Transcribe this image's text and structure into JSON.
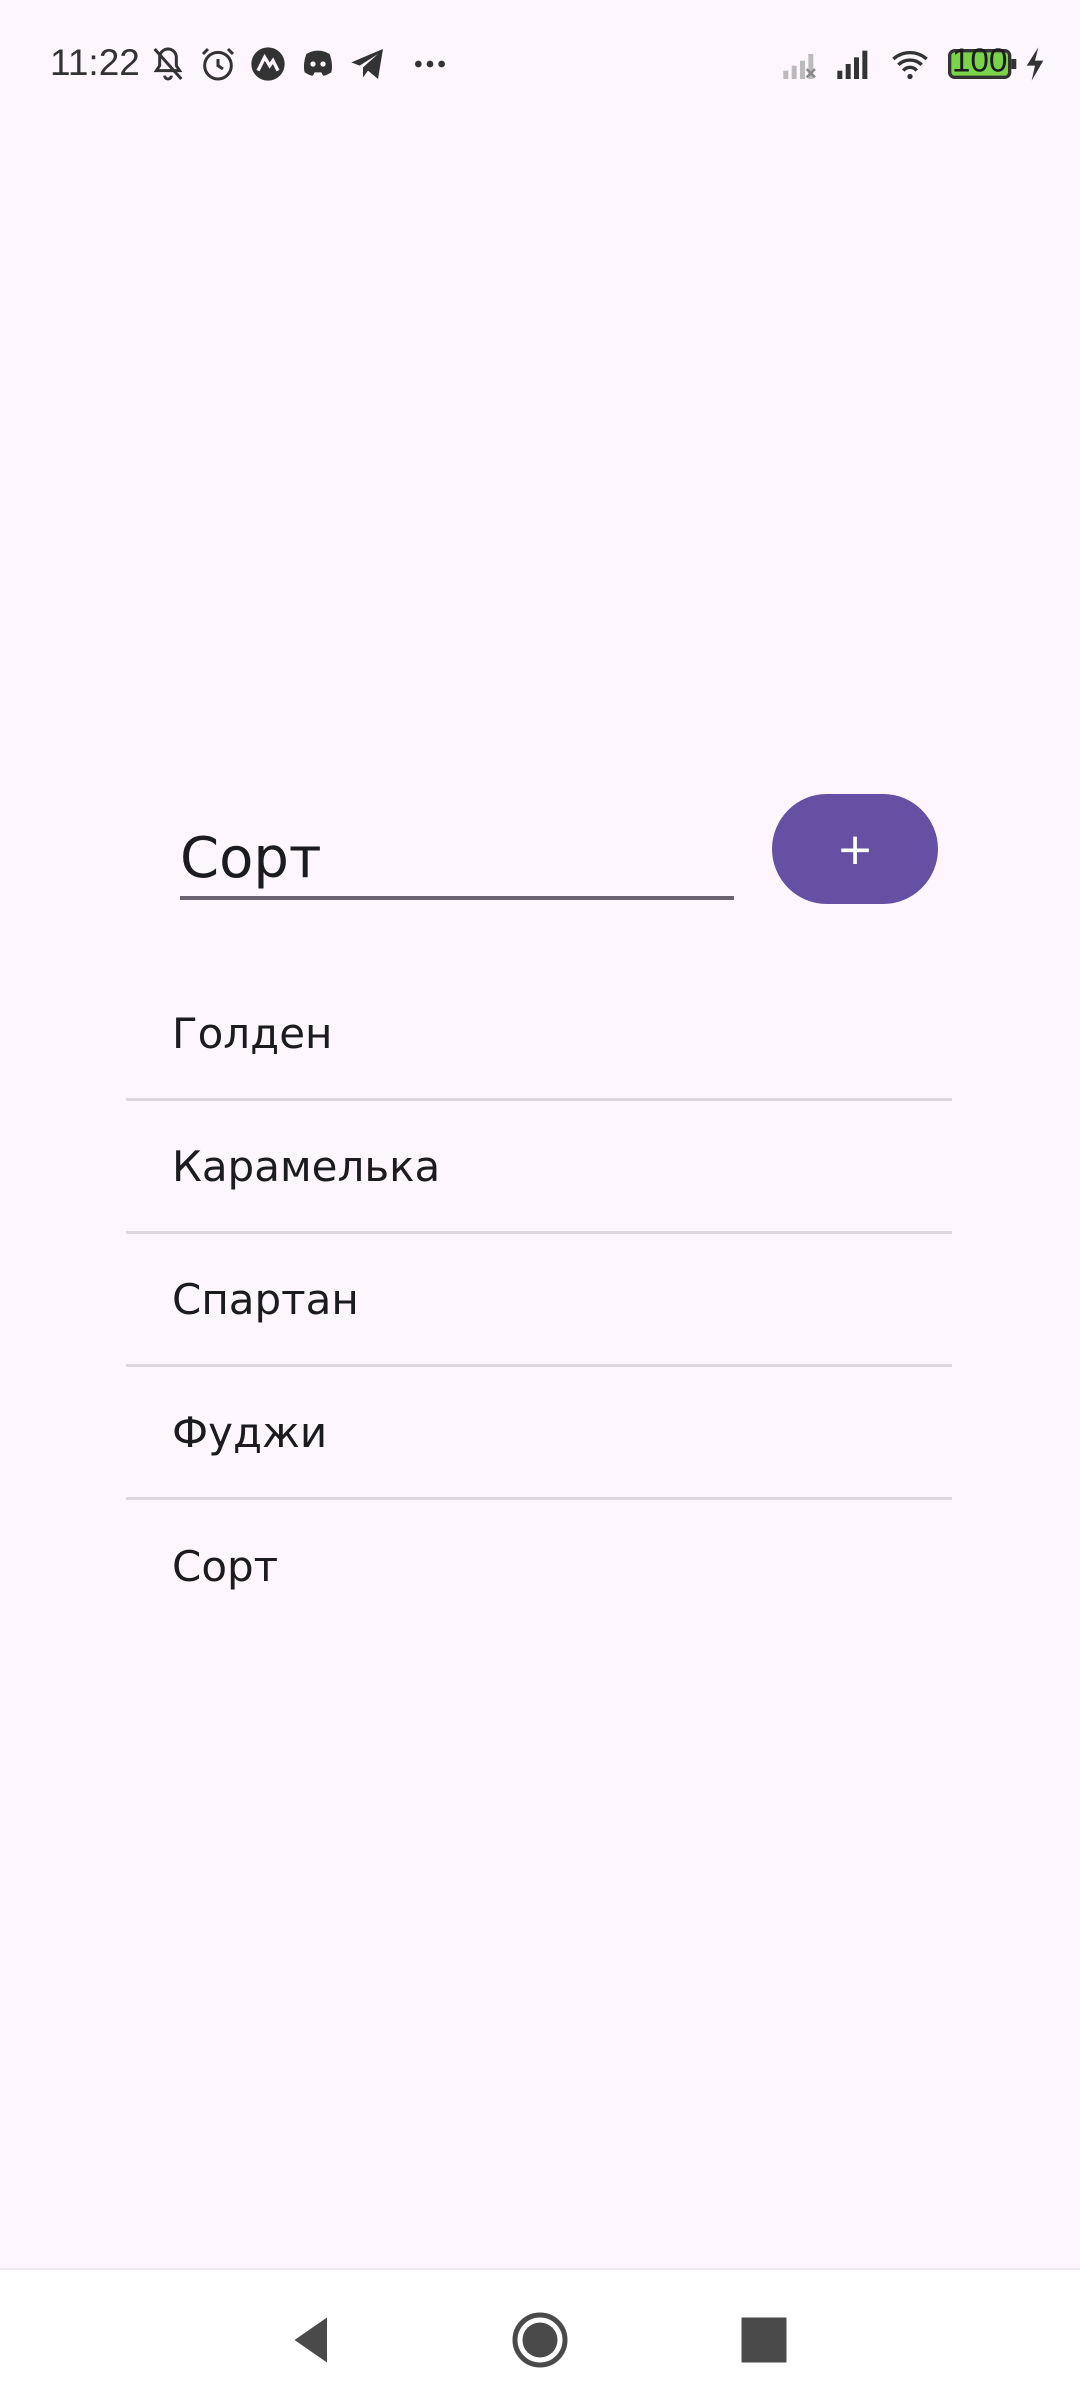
{
  "status_bar": {
    "time": "11:22",
    "battery_level": "100",
    "icons": [
      "bell-off-icon",
      "alarm-icon",
      "app-icon",
      "discord-icon",
      "telegram-icon",
      "more-icon",
      "signal-weak-icon",
      "signal-icon",
      "wifi-icon",
      "battery-icon",
      "charging-icon"
    ]
  },
  "input": {
    "value": "Сорт",
    "add_label": "+"
  },
  "items": [
    "Голден",
    "Карамелька",
    "Спартан",
    "Фуджи",
    "Сорт"
  ],
  "nav": {
    "icons": [
      "back-icon",
      "home-icon",
      "recents-icon"
    ]
  },
  "colors": {
    "background": "#FDF7FD",
    "accent": "#6650A4",
    "divider": "#DCD7DC"
  }
}
